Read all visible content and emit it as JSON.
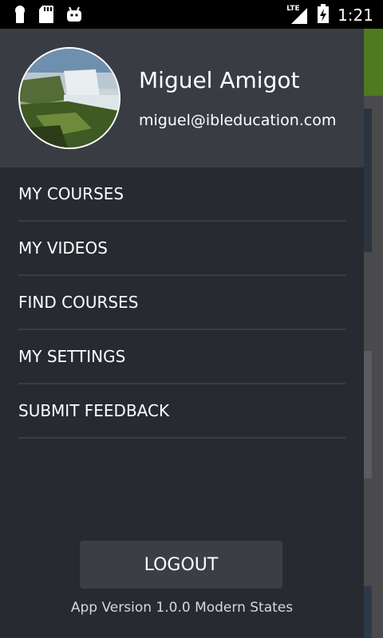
{
  "status_bar": {
    "time": "1:21",
    "network_label": "LTE",
    "icons": [
      "keyhole-icon",
      "sd-card-icon",
      "android-icon",
      "signal-icon",
      "battery-icon"
    ]
  },
  "drawer": {
    "user": {
      "name": "Miguel Amigot",
      "email": "miguel@ibleducation.com"
    },
    "menu": [
      {
        "label": "MY COURSES"
      },
      {
        "label": "MY VIDEOS"
      },
      {
        "label": "FIND COURSES"
      },
      {
        "label": "MY SETTINGS"
      },
      {
        "label": "SUBMIT FEEDBACK"
      }
    ],
    "logout_label": "LOGOUT",
    "version_text": "App Version 1.0.0 Modern States"
  },
  "colors": {
    "drawer_bg": "#272a30",
    "header_bg": "#393c42",
    "accent_green": "#4f7a1e"
  }
}
